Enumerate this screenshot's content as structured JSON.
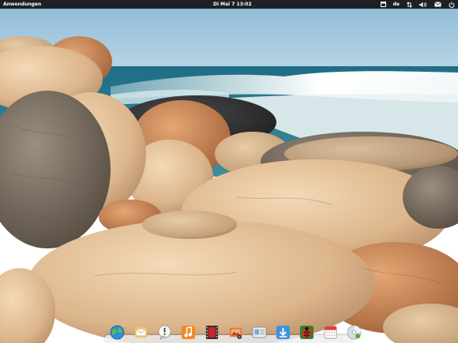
{
  "top_panel": {
    "applications_label": "Anwendungen",
    "clock": "Di Mai  7 13:02",
    "keyboard_layout": "de",
    "indicators": [
      "window-icon",
      "keyboard-layout",
      "network-icon",
      "volume-icon",
      "mail-icon",
      "power-icon"
    ]
  },
  "dock": {
    "items": [
      {
        "name": "midori-browser",
        "icon": "globe-icon"
      },
      {
        "name": "geary-mail",
        "icon": "envelope-icon"
      },
      {
        "name": "postler",
        "icon": "chat-bubble-icon"
      },
      {
        "name": "noise-music",
        "icon": "music-note-icon"
      },
      {
        "name": "totem-videos",
        "icon": "film-icon"
      },
      {
        "name": "shotwell-photos",
        "icon": "photo-icon"
      },
      {
        "name": "switchboard-settings",
        "icon": "settings-panel-icon"
      },
      {
        "name": "software-center",
        "icon": "download-icon"
      },
      {
        "name": "scratch-text-editor",
        "icon": "ladybug-icon"
      },
      {
        "name": "maya-calendar",
        "icon": "calendar-icon"
      },
      {
        "name": "brasero-disc",
        "icon": "disc-icon"
      }
    ]
  },
  "colors": {
    "panel": "#141416",
    "sky": "#9fc5dc",
    "sea": "#2f7d8e",
    "rock": "#e6c19a"
  }
}
